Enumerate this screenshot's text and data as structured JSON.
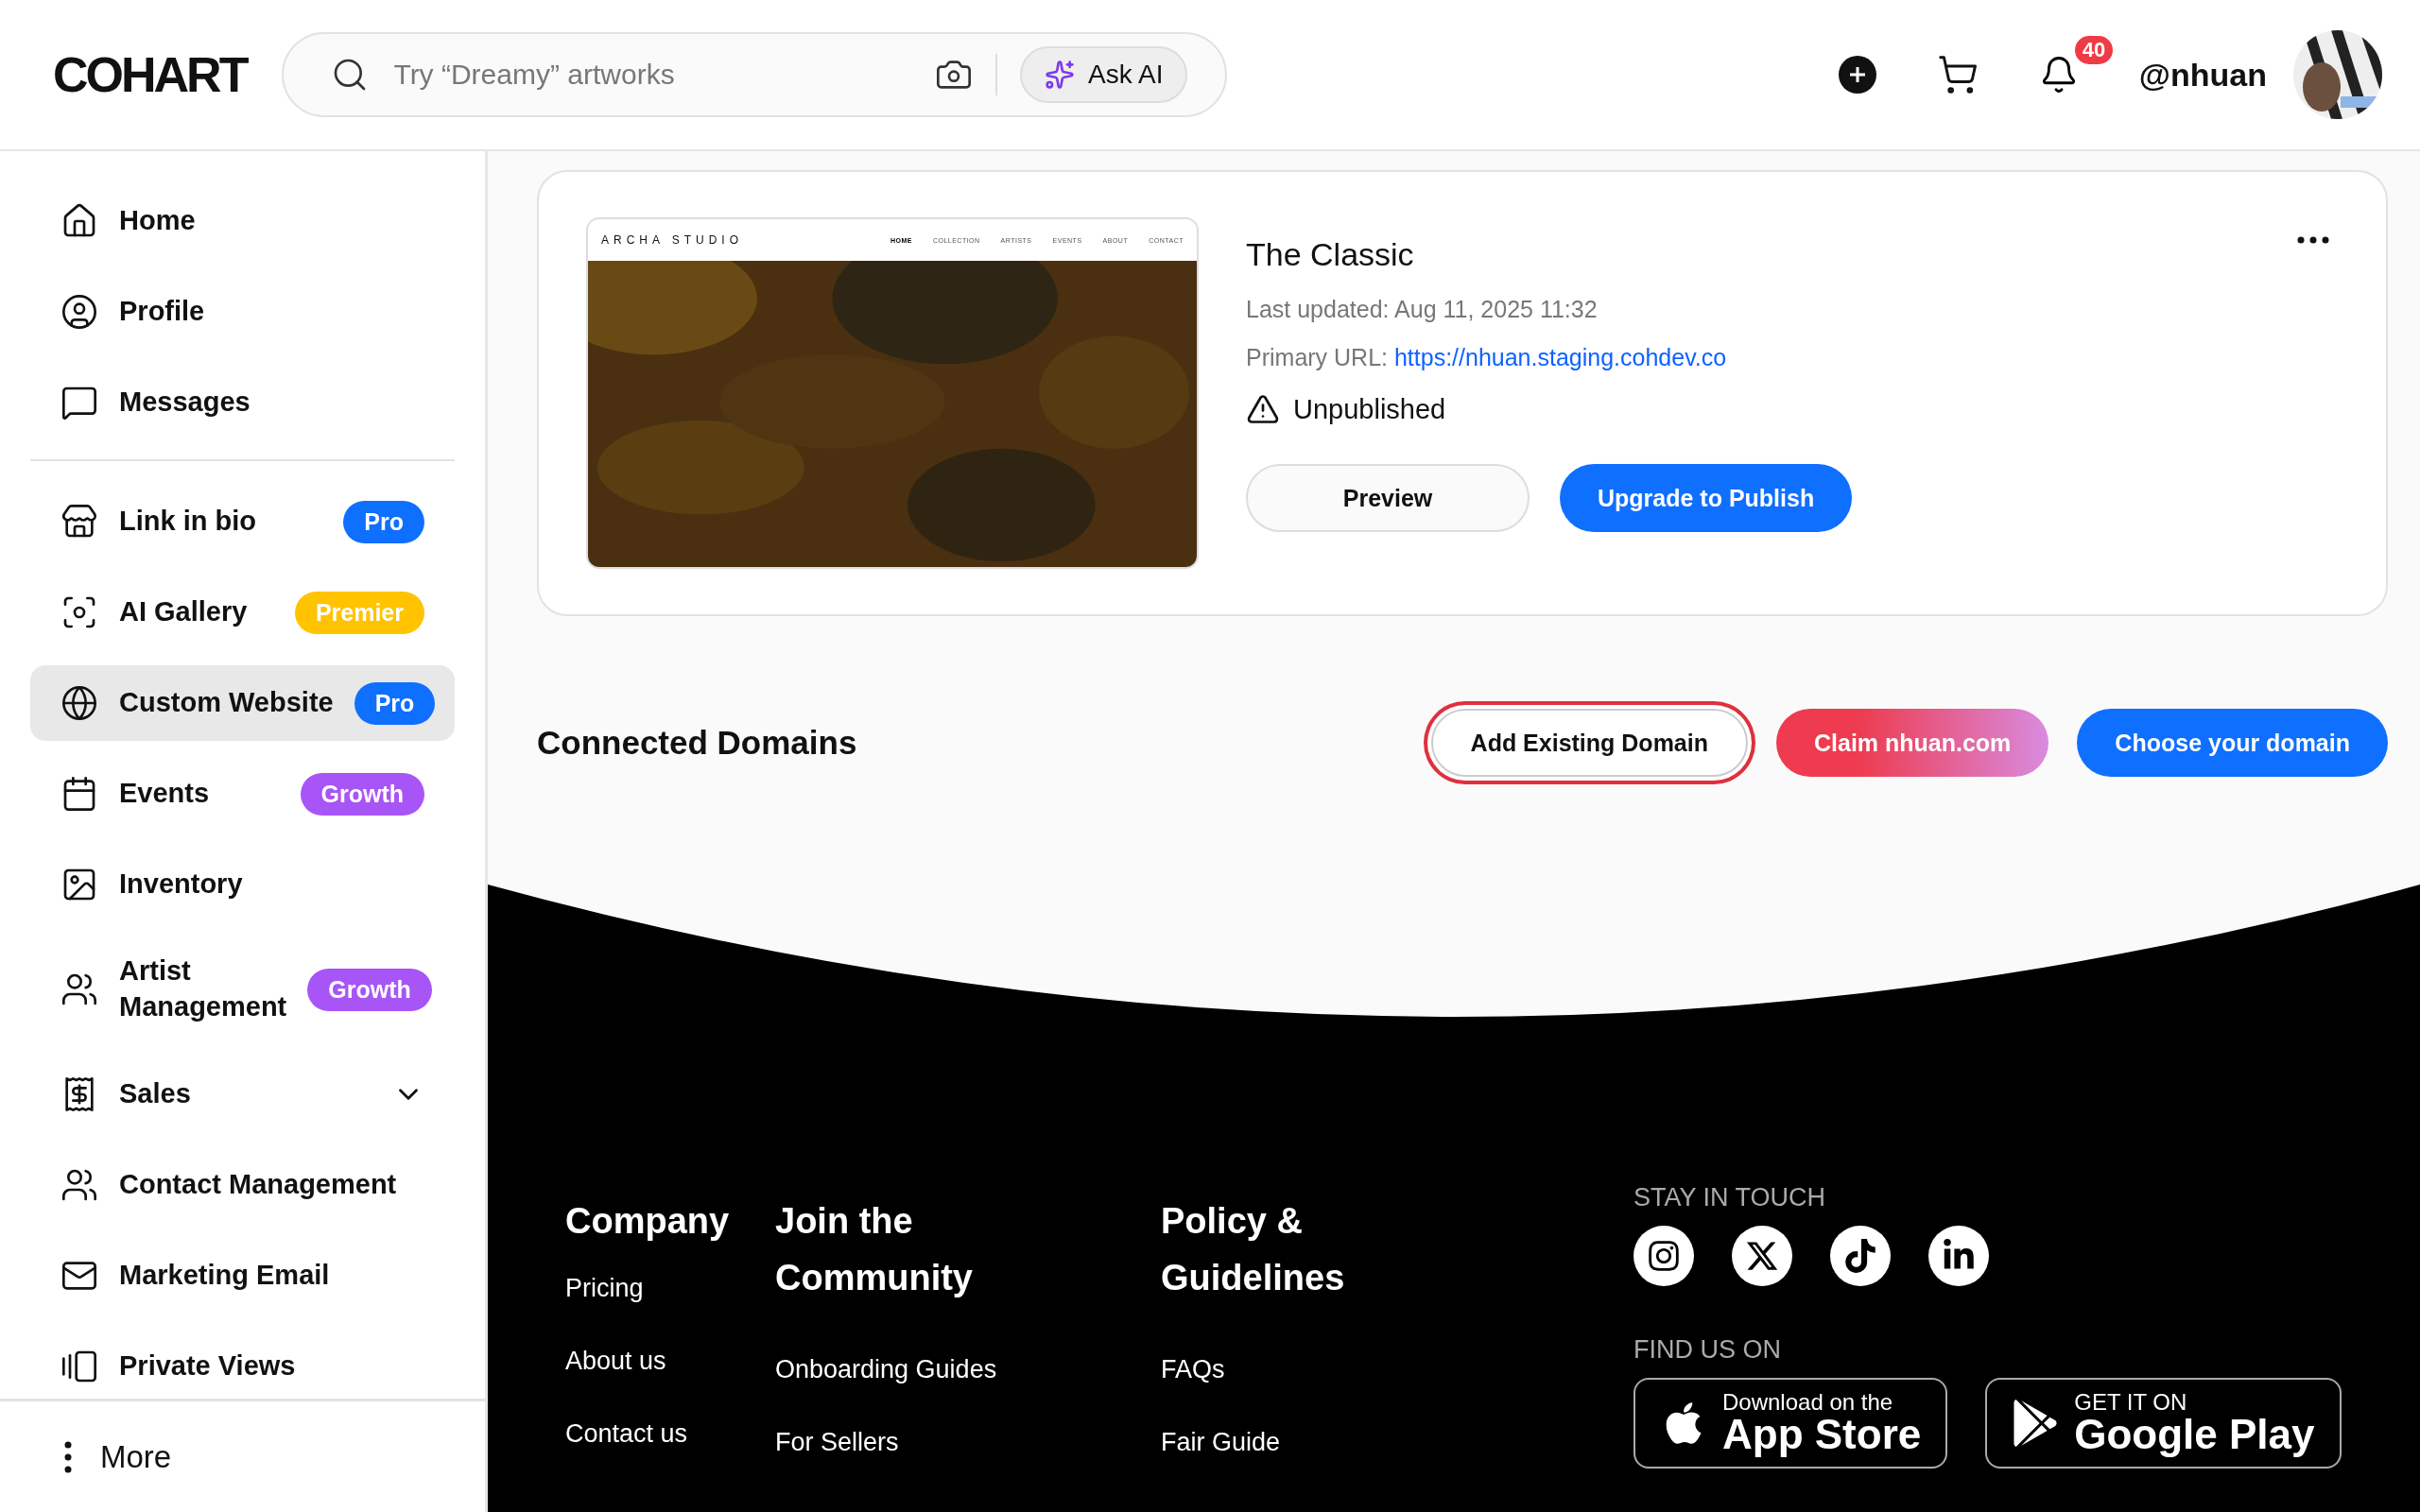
{
  "header": {
    "logo": "COHART",
    "search": {
      "placeholder": "Try “Dreamy” artworks",
      "ask_ai": "Ask AI"
    },
    "notifications": "40",
    "username": "@nhuan"
  },
  "sidebar": {
    "groups": [
      [
        {
          "label": "Home",
          "selected": false
        },
        {
          "label": "Profile",
          "selected": false
        },
        {
          "label": "Messages",
          "selected": false
        }
      ],
      [
        {
          "label": "Link in bio",
          "selected": false,
          "badge": {
            "text": "Pro",
            "color": "#0f6fff"
          }
        },
        {
          "label": "AI Gallery",
          "selected": false,
          "badge": {
            "text": "Premier",
            "color": "#ffc300"
          }
        },
        {
          "label": "Custom Website",
          "selected": true,
          "badge": {
            "text": "Pro",
            "color": "#0f6fff"
          }
        },
        {
          "label": "Events",
          "selected": false,
          "badge": {
            "text": "Growth",
            "color": "#a855f7"
          }
        },
        {
          "label": "Inventory",
          "selected": false
        },
        {
          "label": "Artist Management",
          "selected": false,
          "badge": {
            "text": "Growth",
            "color": "#a855f7"
          }
        },
        {
          "label": "Sales",
          "selected": false,
          "expanded": false
        },
        {
          "label": "Contact Management",
          "selected": false
        },
        {
          "label": "Marketing Email",
          "selected": false
        },
        {
          "label": "Private Views",
          "selected": false
        }
      ]
    ],
    "more": "More"
  },
  "website": {
    "preview": {
      "brand": "ARCHA STUDIO",
      "nav": [
        {
          "label": "HOME",
          "selected": true
        },
        {
          "label": "COLLECTION",
          "selected": false
        },
        {
          "label": "ARTISTS",
          "selected": false
        },
        {
          "label": "EVENTS",
          "selected": false
        },
        {
          "label": "ABOUT",
          "selected": false
        },
        {
          "label": "CONTACT",
          "selected": false
        }
      ],
      "kind": "picture"
    },
    "title": "The Classic",
    "updated": "Last updated: Aug 11, 2025 11:32",
    "url_label": "Primary URL:",
    "url": "https://nhuan.staging.cohdev.co",
    "status": "Unpublished",
    "buttons": [
      {
        "label": "Preview",
        "kind": "secondary"
      },
      {
        "label": "Upgrade to Publish",
        "kind": "primary"
      }
    ]
  },
  "domains": {
    "title": "Connected Domains",
    "buttons": [
      {
        "label": "Add Existing Domain",
        "kind": "outline",
        "focused": true
      },
      {
        "label": "Claim nhuan.com",
        "kind": "gradient",
        "focused": false
      },
      {
        "label": "Choose your domain",
        "kind": "primary",
        "focused": false
      }
    ]
  },
  "footer": {
    "columns": [
      {
        "title": "Company",
        "links": [
          "Pricing",
          "About us",
          "Contact us"
        ]
      },
      {
        "title": "Join the Community",
        "links": [
          "Onboarding Guides",
          "For Sellers"
        ]
      },
      {
        "title": "Policy & Guidelines",
        "links": [
          "FAQs",
          "Fair Guide"
        ]
      }
    ],
    "stay_in_touch": "STAY IN TOUCH",
    "find_us_on": "FIND US ON",
    "stores": [
      {
        "kind": "apple",
        "small": "Download on the",
        "big": "App Store"
      },
      {
        "kind": "google",
        "small": "GET IT ON",
        "big": "Google Play"
      }
    ]
  }
}
